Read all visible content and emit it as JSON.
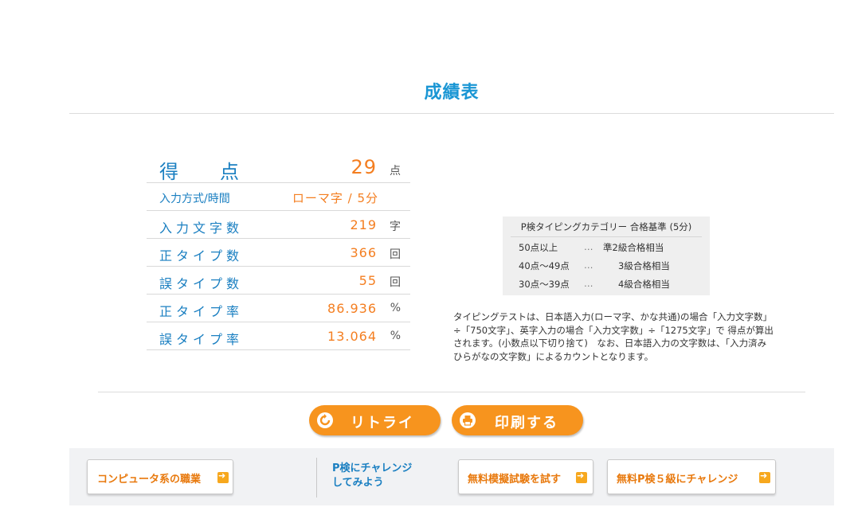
{
  "page": {
    "title": "成績表"
  },
  "score": {
    "point_label_left": "得",
    "point_label_right": "点",
    "point_value": "29",
    "point_unit": "点",
    "rows": [
      {
        "label": "入力方式/時間",
        "value": "ローマ字 / 5分",
        "unit": ""
      },
      {
        "label": "入力文字数",
        "value": "219",
        "unit": "字"
      },
      {
        "label": "正タイプ数",
        "value": "366",
        "unit": "回"
      },
      {
        "label": "誤タイプ数",
        "value": "55",
        "unit": "回"
      },
      {
        "label": "正タイプ率",
        "value": "86.936",
        "unit": "%"
      },
      {
        "label": "誤タイプ率",
        "value": "13.064",
        "unit": "%"
      }
    ]
  },
  "criteria": {
    "heading": "P検タイピングカテゴリー 合格基準 (5分)",
    "dots": "…",
    "rows": [
      {
        "range": "50点以上",
        "grade": "準2級合格相当"
      },
      {
        "range": "40点〜49点",
        "grade": "3級合格相当"
      },
      {
        "range": "30点〜39点",
        "grade": "4級合格相当"
      }
    ]
  },
  "description": "タイピングテストは、日本語入力(ローマ字、かな共通)の場合「入力文字数」÷「750文字」、英字入力の場合「入力文字数」÷「1275文字」で 得点が算出されます。(小数点以下切り捨て)　なお、日本語入力の文字数は、「入力済みひらがなの文字数」によるカウントとなります。",
  "actions": {
    "retry_label": "リトライ",
    "print_label": "印刷する"
  },
  "links": {
    "career_label": "コンピュータ系の職業",
    "challenge_line1": "P検にチャレンジ",
    "challenge_line2": "してみよう",
    "exam_label": "無料模擬試験を試す",
    "grade5_label": "無料P検５級にチャレンジ"
  },
  "colors": {
    "accent_blue": "#1a96d4",
    "accent_orange": "#f47e20",
    "button_orange": "#f7941e"
  }
}
